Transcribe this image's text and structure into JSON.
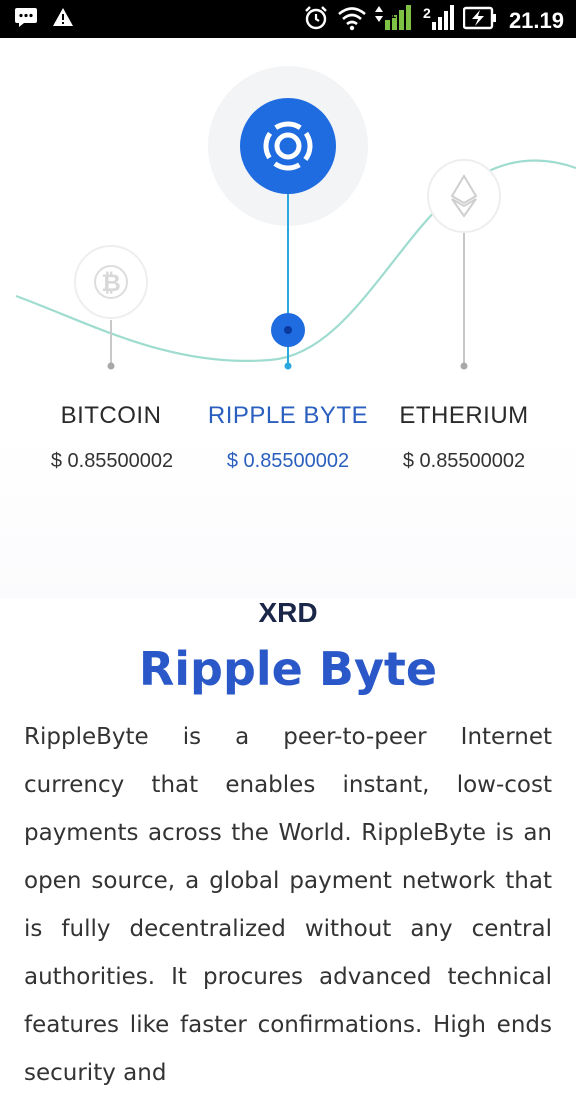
{
  "status_bar": {
    "time": "21.19",
    "icons": [
      "message-icon",
      "warning-icon",
      "alarm-icon",
      "wifi-icon",
      "signal-icon",
      "sim-2-signal-icon",
      "battery-charging-icon"
    ]
  },
  "coins": [
    {
      "name": "BITCOIN",
      "price": "$ 0.85500002",
      "icon": "bitcoin-icon"
    },
    {
      "name": "RIPPLE BYTE",
      "price": "$ 0.85500002",
      "icon": "ripple-byte-icon",
      "active": true
    },
    {
      "name": "ETHERIUM",
      "price": "$ 0.85500002",
      "icon": "ethereum-icon"
    }
  ],
  "content": {
    "kicker": "XRD",
    "title": "Ripple Byte",
    "description": "RippleByte is a peer-to-peer Internet currency that enables instant, low-cost payments across the World. RippleByte is an open source, a global payment network that is fully decentralized without any central authorities. It procures advanced technical features like faster confirmations. High ends security and"
  },
  "colors": {
    "accent": "#2a5fbf",
    "brand_blue": "#1f6be0",
    "curve": "#8fd8c8"
  }
}
